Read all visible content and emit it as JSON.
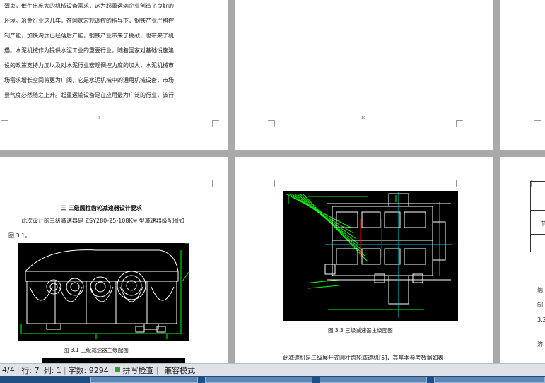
{
  "pages": {
    "p9": {
      "lines": [
        "薄束，催生出庞大的机械设备需求，这为起重运输企业创造了良好的",
        "环境。冶金行业这几年，在国家宏观调控的指导下，钢铁产业严格控",
        "制产能，加快淘汰已经落后产能，钢铁产业带来了挑战，也带来了机",
        "遇。水泥机械作为提供水泥工业的重要行业，随着国家对基础设施建",
        "设的政策支持力度以及对水泥行业宏观调控力度的加大，水泥机械市",
        "场需求增长空间将更为广阔，它是水泥机械中的通用机械设备，市场",
        "景气度必然随之上升。起重运输设备是在应用最为广泛的行业，该行"
      ],
      "page_number": "9"
    },
    "p10": {
      "page_number": "10"
    },
    "p11": {
      "heading": "三  三级圆柱齿轮减速器设计要求",
      "line1": "此次设计的三级减速器是 ZSY280-25-108Kw 型减速器级配图如",
      "line2": "图 3.1。",
      "caption": "图 3.1 三级减速器主级配图"
    },
    "p12": {
      "caption": "图 3.3 三级减速器主级配图",
      "bottom_line": "此减速机是三级展开式圆柱齿轮减速机[5]，其基本参考数据如表"
    },
    "p13": {
      "fragments": [
        "输",
        "制",
        "3.2",
        "济"
      ],
      "table_cell": "节"
    }
  },
  "statusbar": {
    "page": "4/4",
    "row": "行: 7",
    "col": "列: 1",
    "wordcount": "字数: 9294",
    "spellcheck": "拼写检查",
    "compat": "兼容模式"
  },
  "colors": {
    "workspace": "#a9a9a9",
    "cad_background": "#000000",
    "cad_green": "#00ff00",
    "cad_white": "#ffffff",
    "status_bg": "#dfe3e8",
    "taskbar": "#1f4e82"
  }
}
